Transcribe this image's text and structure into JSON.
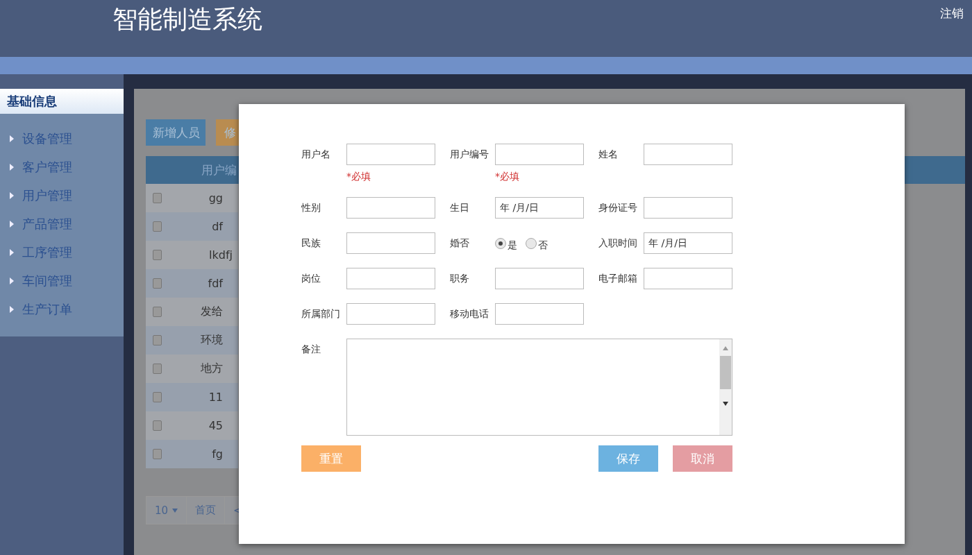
{
  "header": {
    "title": "智能制造系统",
    "logout": "注销"
  },
  "sidebar": {
    "section": "基础信息",
    "items": [
      {
        "label": "设备管理"
      },
      {
        "label": "客户管理"
      },
      {
        "label": "用户管理"
      },
      {
        "label": "产品管理"
      },
      {
        "label": "工序管理"
      },
      {
        "label": "车间管理"
      },
      {
        "label": "生产订单"
      }
    ]
  },
  "toolbar": {
    "buttons": [
      {
        "label": "新增人员",
        "kind": "add"
      },
      {
        "label": "修",
        "kind": "edit"
      }
    ]
  },
  "table": {
    "columns": [
      "用户编"
    ],
    "rows": [
      {
        "checked": false,
        "value": "gg"
      },
      {
        "checked": false,
        "value": "df"
      },
      {
        "checked": false,
        "value": "lkdfj"
      },
      {
        "checked": false,
        "value": "fdf"
      },
      {
        "checked": false,
        "value": "发给"
      },
      {
        "checked": false,
        "value": "环境"
      },
      {
        "checked": false,
        "value": "地方"
      },
      {
        "checked": false,
        "value": "11"
      },
      {
        "checked": false,
        "value": "45"
      },
      {
        "checked": false,
        "value": "fg"
      }
    ]
  },
  "pagination": {
    "page_size": "10",
    "first": "首页",
    "prev": "<"
  },
  "dialog": {
    "fields": [
      {
        "label": "用户名",
        "kind": "text",
        "hint": "*必填"
      },
      {
        "label": "用户编号",
        "kind": "text",
        "hint": "*必填"
      },
      {
        "label": "姓名",
        "kind": "text"
      },
      {
        "label": "性别",
        "kind": "text"
      },
      {
        "label": "生日",
        "kind": "date",
        "value": "年 /月/日"
      },
      {
        "label": "身份证号",
        "kind": "text"
      },
      {
        "label": "民族",
        "kind": "text"
      },
      {
        "label": "婚否",
        "kind": "radio",
        "options": [
          {
            "label": "是",
            "selected": true
          },
          {
            "label": "否",
            "selected": false
          }
        ]
      },
      {
        "label": "入职时间",
        "kind": "date",
        "value": "年 /月/日"
      },
      {
        "label": "岗位",
        "kind": "text"
      },
      {
        "label": "职务",
        "kind": "text"
      },
      {
        "label": "电子邮箱",
        "kind": "text"
      },
      {
        "label": "所属部门",
        "kind": "text"
      },
      {
        "label": "移动电话",
        "kind": "text"
      }
    ],
    "remarks": {
      "label": "备注"
    },
    "buttons": [
      {
        "label": "重置",
        "kind": "reset"
      },
      {
        "label": "保存",
        "kind": "save"
      },
      {
        "label": "取消",
        "kind": "cancel"
      }
    ]
  }
}
